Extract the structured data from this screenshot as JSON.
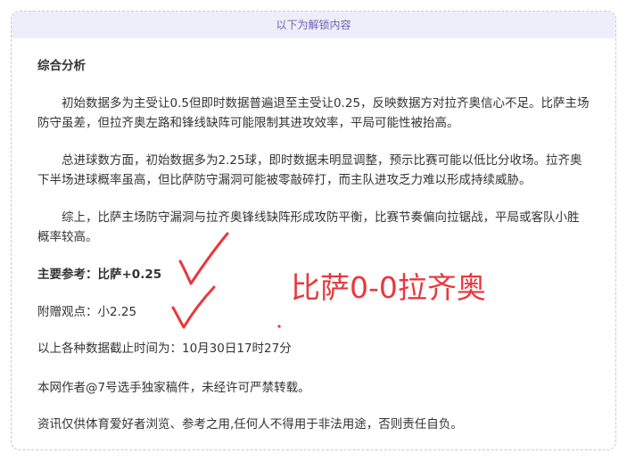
{
  "header": {
    "label": "以下为解锁内容"
  },
  "article": {
    "section_title": "综合分析",
    "para1": "初始数据多为主受让0.5但即时数据普遍退至主受让0.25，反映数据方对拉齐奥信心不足。比萨主场防守虽差，但拉齐奥左路和锋线缺阵可能限制其进攻效率，平局可能性被抬高。",
    "para2": "总进球数方面，初始数据多为2.25球，即时数据未明显调整，预示比赛可能以低比分收场。拉齐奥下半场进球概率虽高，但比萨防守漏洞可能被零敲碎打，而主队进攻乏力难以形成持续威胁。",
    "para3": "综上，比萨主场防守漏洞与拉齐奥锋线缺阵形成攻防平衡，比赛节奏偏向拉锯战，平局或客队小胜概率较高。",
    "main_ref": "主要参考：比萨+0.25",
    "extra_view": "附赠观点：小2.25",
    "cutoff": "以上各种数据截止时间为：10月30日17时27分",
    "copyright": "本网作者@7号选手独家稿件，未经许可严禁转载。",
    "disclaimer": "资讯仅供体育爱好者浏览、参考之用,任何人不得用于非法用途，否则责任自负。"
  },
  "annotation": {
    "result_text": "比萨0-0拉齐奥",
    "ink_color": "#e8383d"
  }
}
